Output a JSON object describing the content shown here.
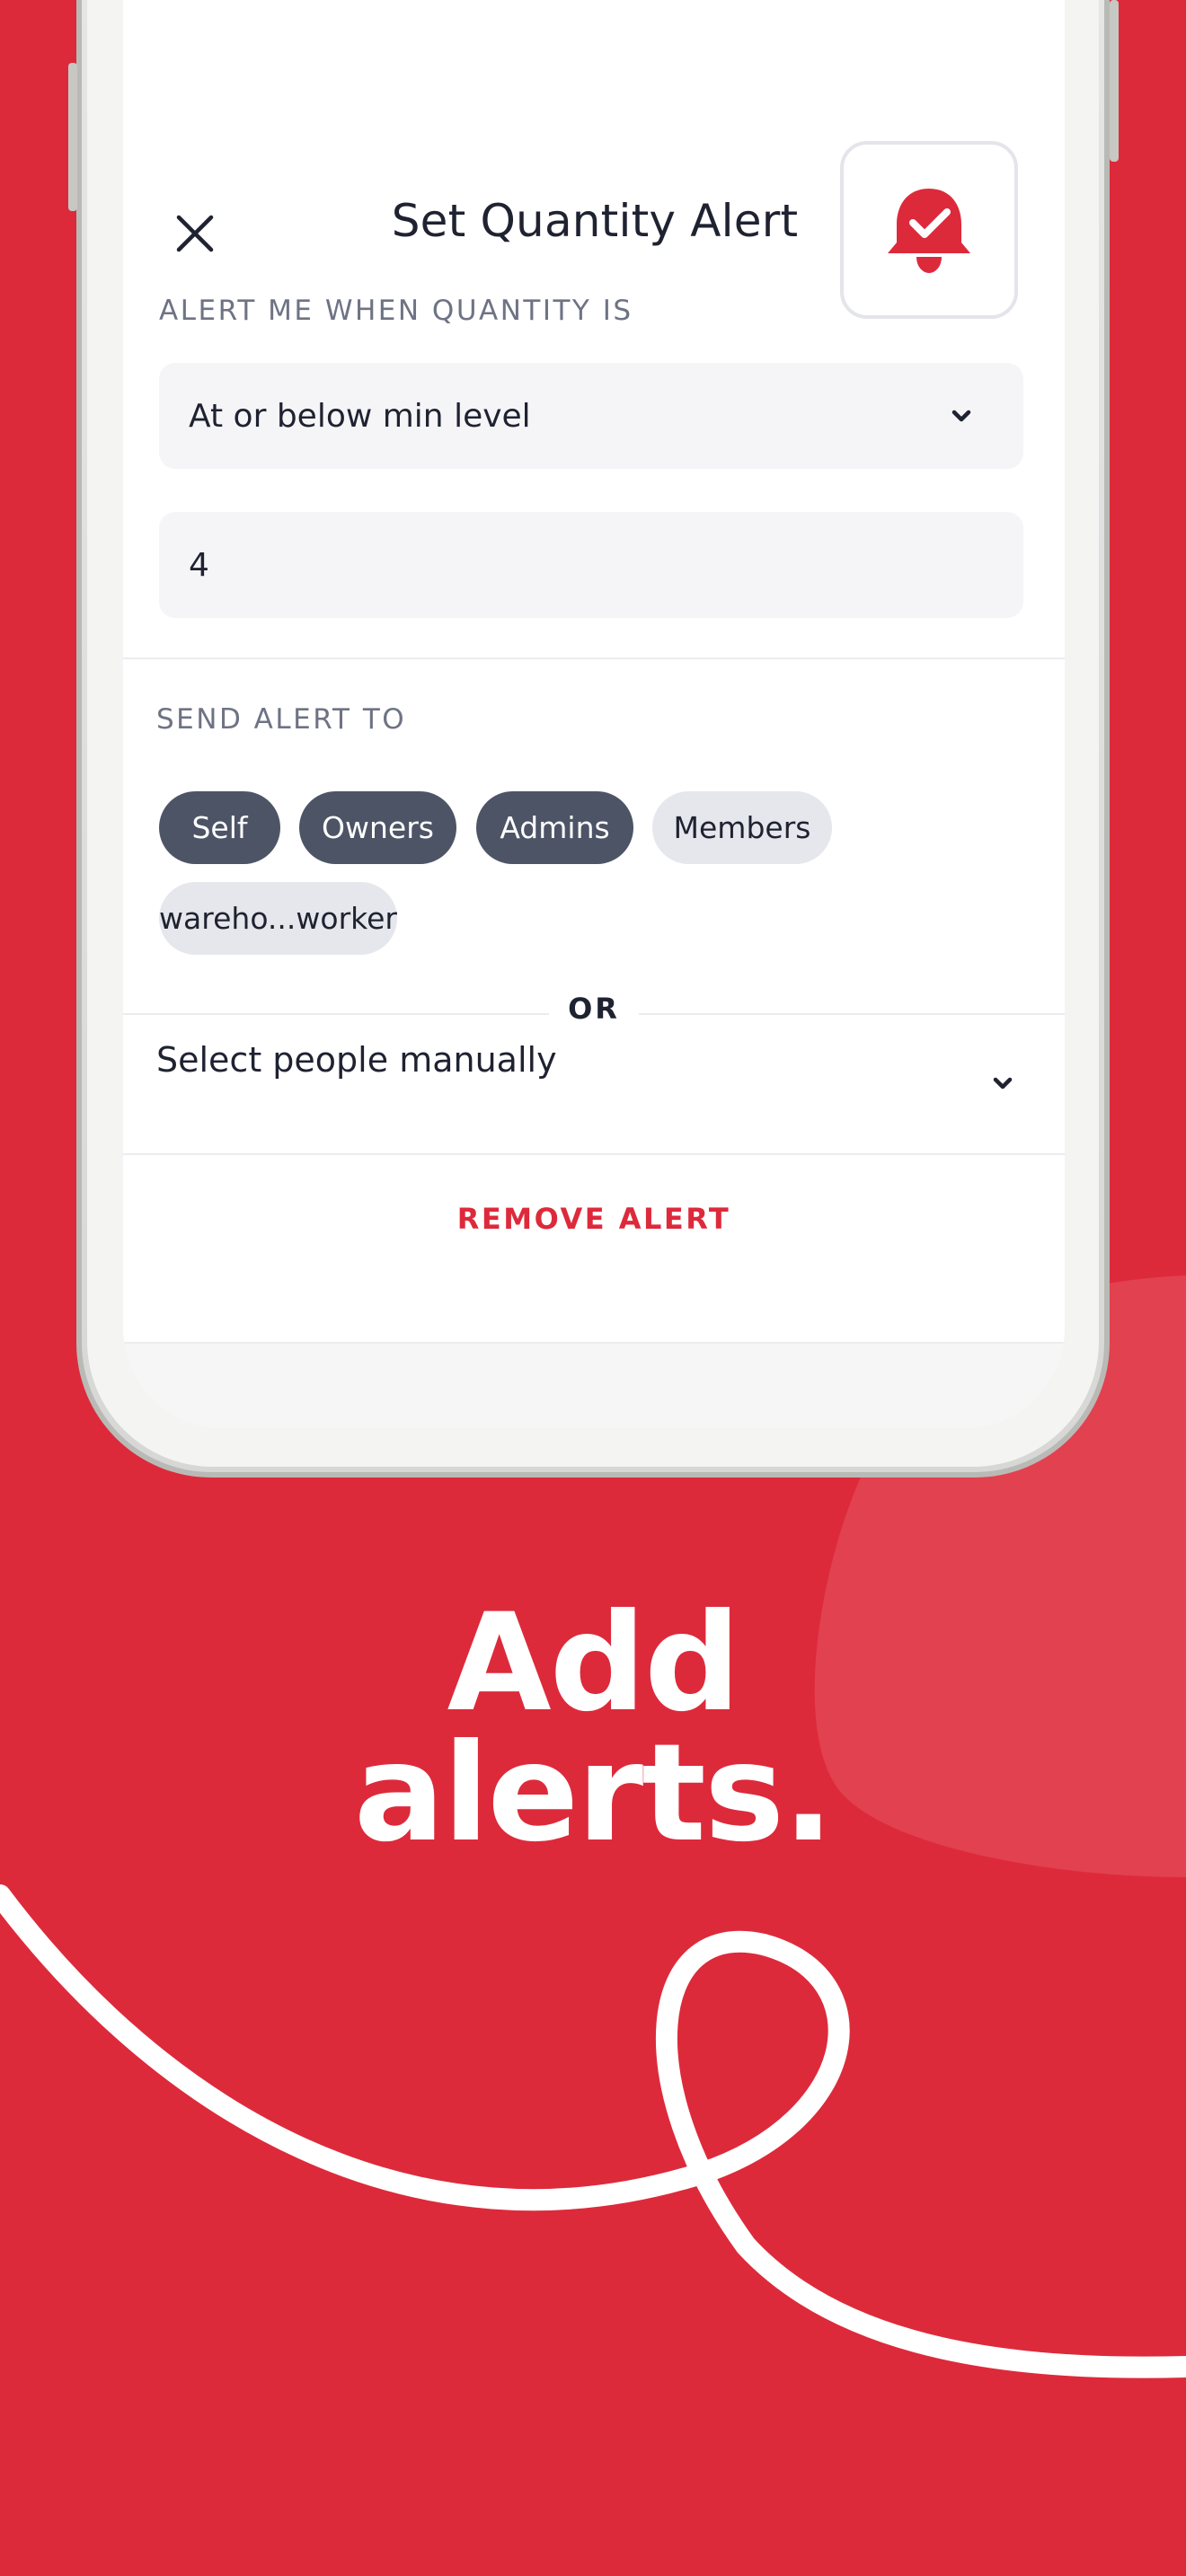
{
  "modal": {
    "title": "Set Quantity Alert",
    "close_icon": "close-icon",
    "badge_icon": "bell-check-icon"
  },
  "alert_condition": {
    "label": "ALERT ME WHEN QUANTITY IS",
    "selected": "At or below min level",
    "quantity_value": "4"
  },
  "recipients": {
    "label": "SEND ALERT TO",
    "chips": [
      {
        "label": "Self",
        "selected": true
      },
      {
        "label": "Owners",
        "selected": true
      },
      {
        "label": "Admins",
        "selected": true
      },
      {
        "label": "Members",
        "selected": false
      },
      {
        "label": "wareho...worker",
        "selected": false
      }
    ],
    "or_label": "OR",
    "manual_select": "Select people manually"
  },
  "actions": {
    "remove_alert": "REMOVE ALERT"
  },
  "headline": {
    "line1": "Add",
    "line2": "alerts."
  },
  "colors": {
    "brand_red": "#dd2a3b",
    "chip_selected": "#4d5466",
    "chip_unselected": "#e6e7ec"
  }
}
